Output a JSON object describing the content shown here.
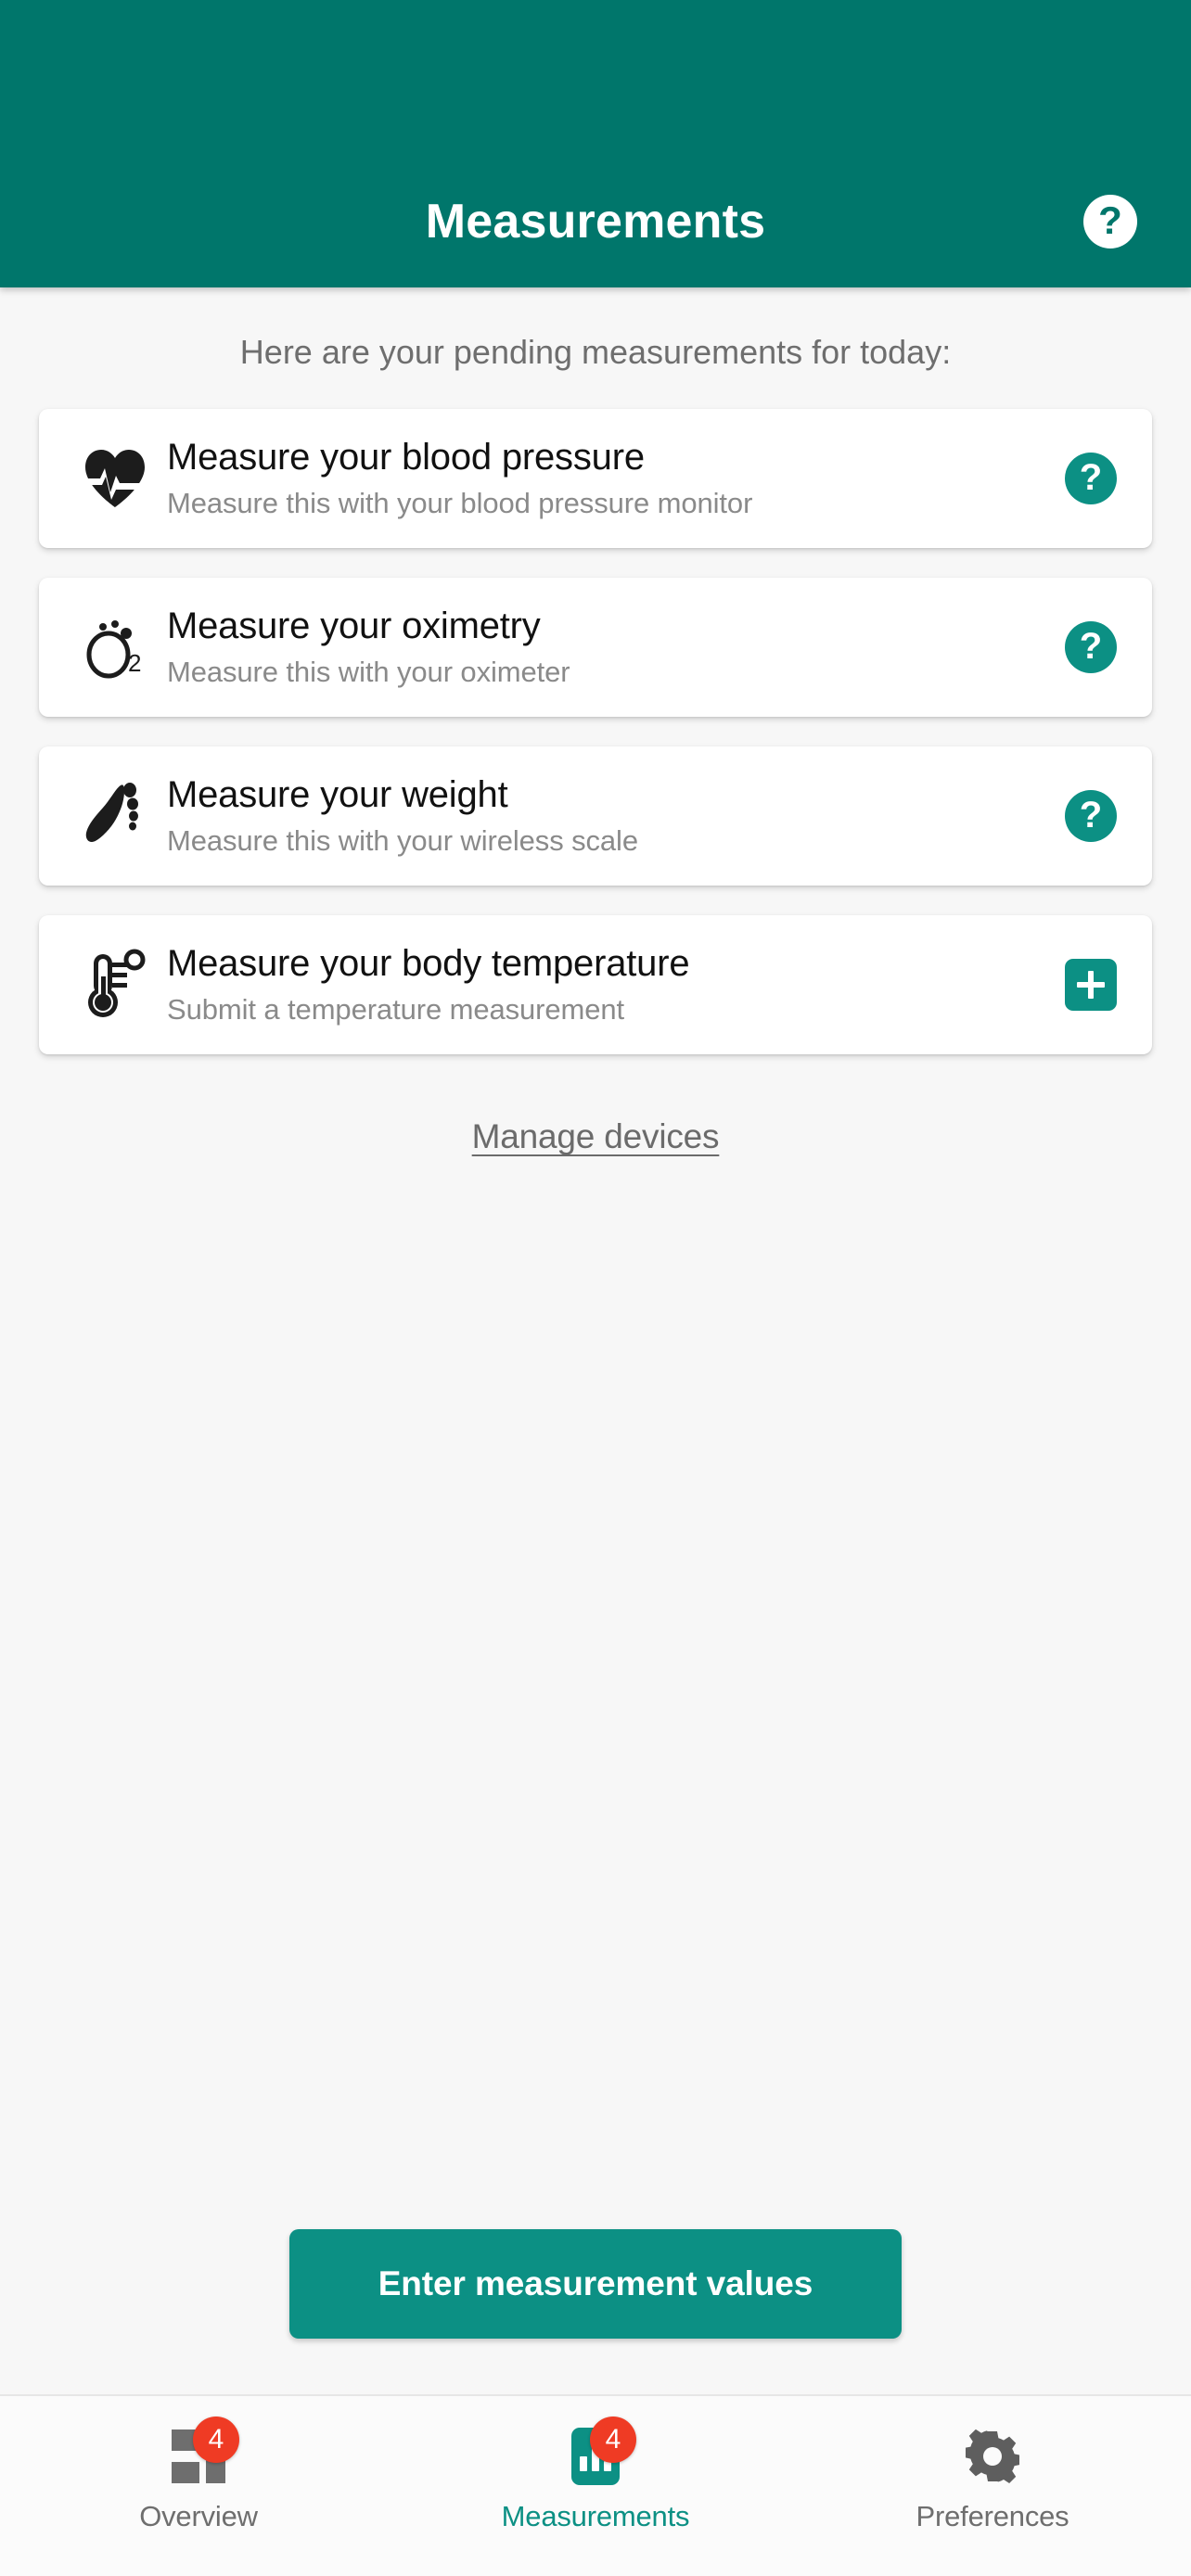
{
  "header": {
    "title": "Measurements",
    "help_icon": "help-circle-icon",
    "background_color": "#00766b"
  },
  "content": {
    "intro_text": "Here are your pending measurements for today:",
    "manage_devices_label": "Manage devices",
    "cta_label": "Enter measurement values"
  },
  "measurements": [
    {
      "icon": "heart-pulse-icon",
      "title": "Measure your blood pressure",
      "subtitle": "Measure this with your blood pressure monitor",
      "action": "help",
      "action_icon": "help-circle-icon"
    },
    {
      "icon": "oxygen-o2-icon",
      "title": "Measure your oximetry",
      "subtitle": "Measure this with your oximeter",
      "action": "help",
      "action_icon": "help-circle-icon"
    },
    {
      "icon": "footprint-icon",
      "title": "Measure your weight",
      "subtitle": "Measure this with your wireless scale",
      "action": "help",
      "action_icon": "help-circle-icon"
    },
    {
      "icon": "thermometer-icon",
      "title": "Measure your body temperature",
      "subtitle": "Submit a temperature measurement",
      "action": "add",
      "action_icon": "plus-icon"
    }
  ],
  "bottom_nav": [
    {
      "label": "Overview",
      "icon": "dashboard-grid-icon",
      "badge": "4",
      "active": false
    },
    {
      "label": "Measurements",
      "icon": "bar-chart-icon",
      "badge": "4",
      "active": true
    },
    {
      "label": "Preferences",
      "icon": "gear-icon",
      "badge": "",
      "active": false
    }
  ],
  "colors": {
    "header_teal": "#00766b",
    "accent_teal": "#0c9084",
    "badge_red": "#ef3b24",
    "page_background": "#f7f7f7",
    "card_background": "#ffffff",
    "muted_text": "#8a8a8a"
  }
}
